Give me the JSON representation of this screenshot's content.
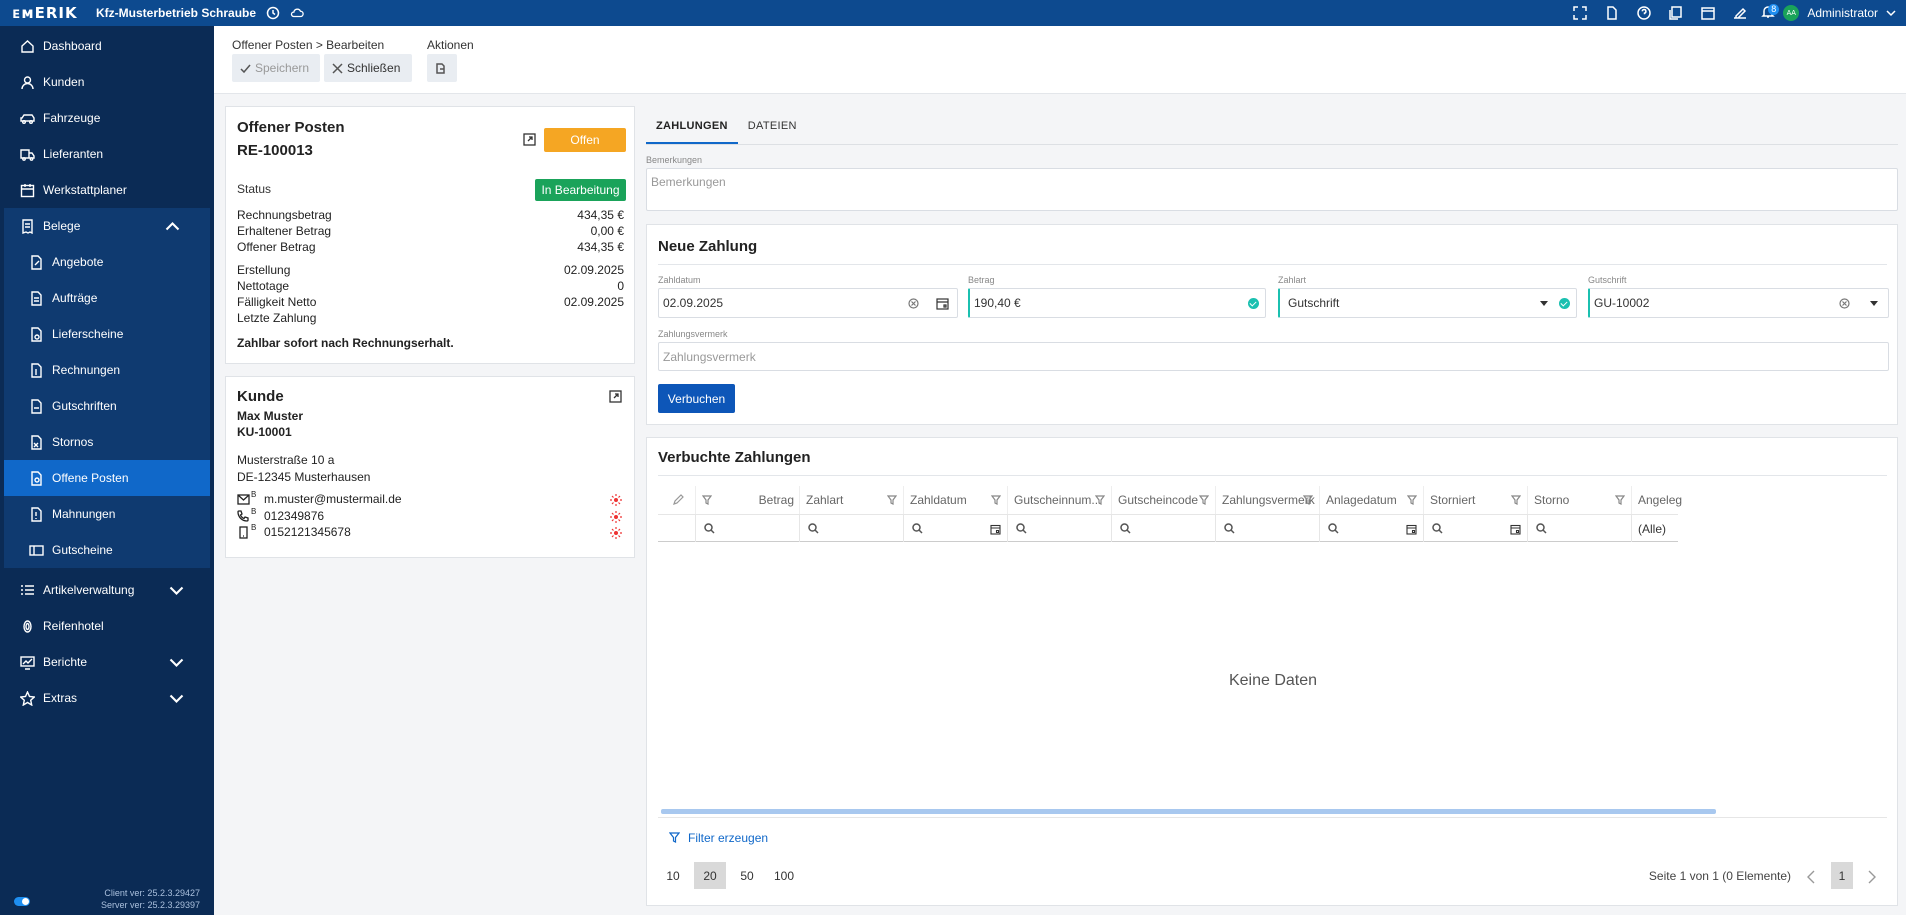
{
  "topbar": {
    "logo": "ᴇᴍERIK",
    "company": "Kfz-Musterbetrieb Schraube",
    "notification_count": "8",
    "avatar_initials": "AA",
    "user": "Administrator"
  },
  "sidebar": {
    "items": [
      {
        "label": "Dashboard",
        "icon": "home-icon"
      },
      {
        "label": "Kunden",
        "icon": "user-icon"
      },
      {
        "label": "Fahrzeuge",
        "icon": "car-icon"
      },
      {
        "label": "Lieferanten",
        "icon": "truck-icon"
      },
      {
        "label": "Werkstattplaner",
        "icon": "calendar-icon"
      }
    ],
    "belege": {
      "label": "Belege",
      "items": [
        "Angebote",
        "Aufträge",
        "Lieferscheine",
        "Rechnungen",
        "Gutschriften",
        "Stornos",
        "Offene Posten",
        "Mahnungen",
        "Gutscheine"
      ],
      "active": "Offene Posten"
    },
    "bottom_items": [
      {
        "label": "Artikelverwaltung",
        "icon": "list-icon",
        "expandable": true
      },
      {
        "label": "Reifenhotel",
        "icon": "tire-icon",
        "expandable": false
      },
      {
        "label": "Berichte",
        "icon": "chart-icon",
        "expandable": true
      },
      {
        "label": "Extras",
        "icon": "star-icon",
        "expandable": true
      }
    ],
    "client_version": "Client ver: 25.2.3.29427",
    "server_version": "Server ver: 25.2.3.29397"
  },
  "toolbar": {
    "breadcrumb": "Offener Posten > Bearbeiten",
    "save_label": "Speichern",
    "close_label": "Schließen",
    "actions_label": "Aktionen"
  },
  "posten": {
    "title": "Offener Posten",
    "number": "RE-100013",
    "state_badge": "Offen",
    "status_label": "Status",
    "status_value": "In Bearbeitung",
    "rows1": [
      {
        "label": "Rechnungsbetrag",
        "value": "434,35 €"
      },
      {
        "label": "Erhaltener Betrag",
        "value": "0,00 €"
      },
      {
        "label": "Offener Betrag",
        "value": "434,35 €"
      }
    ],
    "rows2": [
      {
        "label": "Erstellung",
        "value": "02.09.2025"
      },
      {
        "label": "Nettotage",
        "value": "0"
      },
      {
        "label": "Fälligkeit Netto",
        "value": "02.09.2025"
      },
      {
        "label": "Letzte Zahlung",
        "value": ""
      }
    ],
    "note": "Zahlbar sofort nach Rechnungserhalt."
  },
  "kunde": {
    "title": "Kunde",
    "name": "Max Muster",
    "number": "KU-10001",
    "street": "Musterstraße 10 a",
    "city": "DE-12345 Musterhausen",
    "email": "m.muster@mustermail.de",
    "phone": "012349876",
    "mobile": "0152121345678",
    "contact_suffix": "B"
  },
  "tabs": [
    "ZAHLUNGEN",
    "DATEIEN"
  ],
  "bemerkungen": {
    "label": "Bemerkungen",
    "placeholder": "Bemerkungen"
  },
  "neue_zahlung": {
    "title": "Neue Zahlung",
    "zahldatum_label": "Zahldatum",
    "zahldatum": "02.09.2025",
    "betrag_label": "Betrag",
    "betrag": "190,40 €",
    "zahlart_label": "Zahlart",
    "zahlart": "Gutschrift",
    "gutschrift_label": "Gutschrift",
    "gutschrift": "GU-10002",
    "vermerk_label": "Zahlungsvermerk",
    "vermerk_placeholder": "Zahlungsvermerk",
    "submit": "Verbuchen"
  },
  "verbuchte": {
    "title": "Verbuchte Zahlungen",
    "columns": [
      "Betrag",
      "Zahlart",
      "Zahldatum",
      "Gutscheinnum...",
      "Gutscheincode",
      "Zahlungsvermerk",
      "Anlagedatum",
      "Storniert",
      "Storno",
      "Angeleg"
    ],
    "filter_all": "(Alle)",
    "no_data": "Keine Daten",
    "filter_create": "Filter erzeugen",
    "page_sizes": [
      "10",
      "20",
      "50",
      "100"
    ],
    "selected_page_size": "20",
    "page_info": "Seite 1 von 1 (0 Elemente)",
    "current_page": "1"
  },
  "colors": {
    "topbar": "#0d4a8f",
    "sidebar": "#0b2b55",
    "active": "#1068c9",
    "orange": "#f5a623",
    "green": "#1aa35a",
    "primary": "#0d56b8"
  }
}
